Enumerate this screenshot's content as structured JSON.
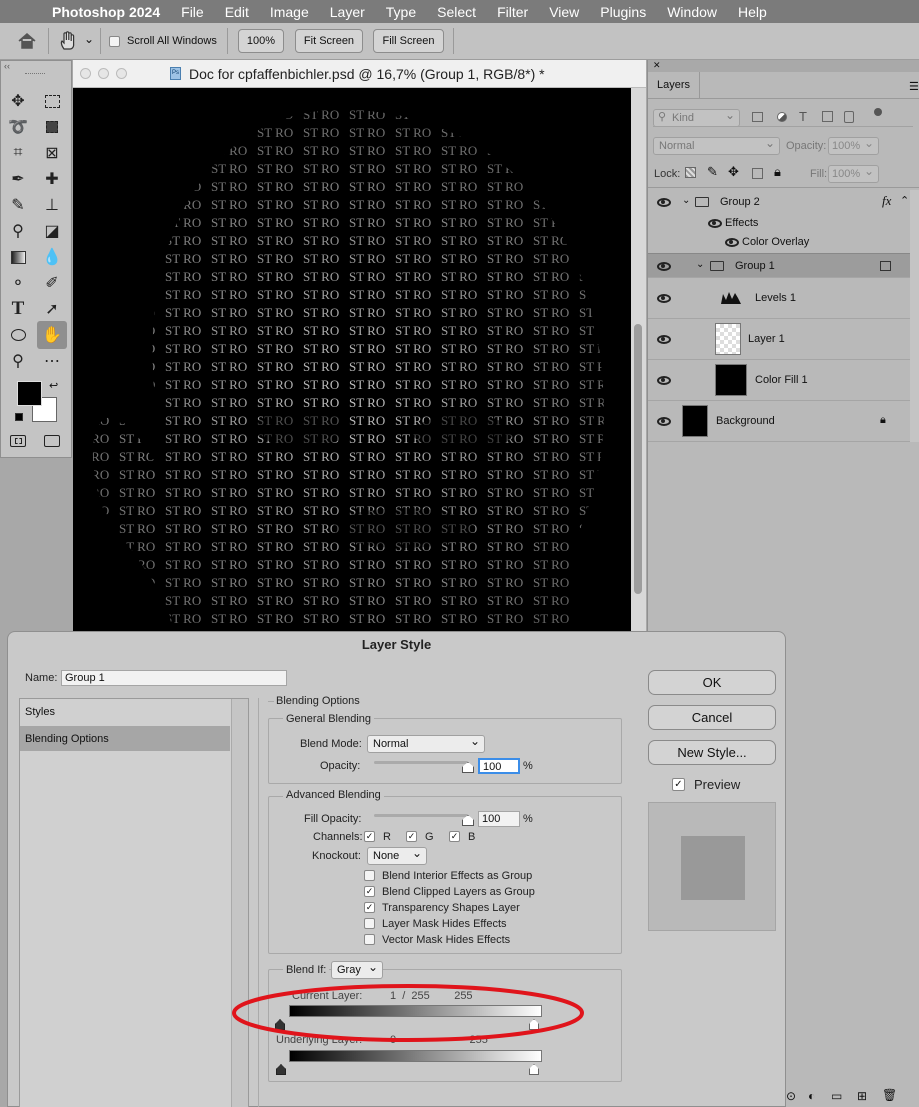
{
  "menubar": {
    "app": "Photoshop 2024",
    "items": [
      "File",
      "Edit",
      "Image",
      "Layer",
      "Type",
      "Select",
      "Filter",
      "View",
      "Plugins",
      "Window",
      "Help"
    ]
  },
  "options": {
    "scroll_all_windows": "Scroll All Windows",
    "zoom_100": "100%",
    "fit_screen": "Fit Screen",
    "fill_screen": "Fill Screen"
  },
  "document": {
    "title": "Doc for cpfaffenbichler.psd @ 16,7% (Group 1, RGB/8*) *",
    "file_badge": "Ps"
  },
  "layers_panel": {
    "tab": "Layers",
    "kind_filter": "Kind",
    "blend_mode": "Normal",
    "opacity_label": "Opacity:",
    "opacity_value": "100%",
    "lock_label": "Lock:",
    "fill_label": "Fill:",
    "fill_value": "100%",
    "fx_label": "fx",
    "rows": [
      {
        "name": "Group 2"
      },
      {
        "name": "Effects"
      },
      {
        "name": "Color Overlay"
      },
      {
        "name": "Group 1"
      },
      {
        "name": "Levels 1"
      },
      {
        "name": "Layer 1"
      },
      {
        "name": "Color Fill 1"
      },
      {
        "name": "Background"
      }
    ]
  },
  "dialog": {
    "title": "Layer Style",
    "name_label": "Name:",
    "name_value": "Group 1",
    "left_list": [
      "Styles",
      "Blending Options"
    ],
    "section_title": "Blending Options",
    "general_blending": "General Blending",
    "blend_mode_label": "Blend Mode:",
    "blend_mode_value": "Normal",
    "opacity_label": "Opacity:",
    "opacity_value": "100",
    "percent": "%",
    "advanced_blending": "Advanced Blending",
    "fill_opacity_label": "Fill Opacity:",
    "fill_opacity_value": "100",
    "channels_label": "Channels:",
    "channel_r": "R",
    "channel_g": "G",
    "channel_b": "B",
    "knockout_label": "Knockout:",
    "knockout_value": "None",
    "checkboxes": [
      {
        "label": "Blend Interior Effects as Group",
        "checked": false
      },
      {
        "label": "Blend Clipped Layers as Group",
        "checked": true
      },
      {
        "label": "Transparency Shapes Layer",
        "checked": true
      },
      {
        "label": "Layer Mask Hides Effects",
        "checked": false
      },
      {
        "label": "Vector Mask Hides Effects",
        "checked": false
      }
    ],
    "blend_if_label": "Blend If:",
    "blend_if_value": "Gray",
    "current_layer_label": "Current Layer:",
    "current_layer_values": "1  /  255        255",
    "underlying_layer_label": "Underlying Layer:",
    "underlying_layer_values": "0                        255",
    "buttons": {
      "ok": "OK",
      "cancel": "Cancel",
      "new_style": "New Style..."
    },
    "preview_label": "Preview",
    "preview_checked": true
  },
  "colors": {
    "annotation_ellipse": "#e0141b",
    "selected_row": "#9c9c9c",
    "opacity_focus": "#3b8de8"
  }
}
